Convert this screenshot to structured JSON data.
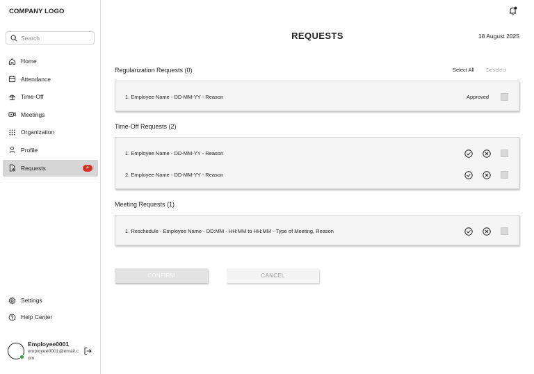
{
  "sidebar": {
    "logo": "COMPANY LOGO",
    "search_placeholder": "Search",
    "items": [
      {
        "label": "Home",
        "icon": "home-icon"
      },
      {
        "label": "Attendance",
        "icon": "calendar-icon"
      },
      {
        "label": "Time-Off",
        "icon": "beach-icon"
      },
      {
        "label": "Meetings",
        "icon": "video-icon"
      },
      {
        "label": "Organization",
        "icon": "grid-icon"
      },
      {
        "label": "Profile",
        "icon": "user-icon"
      },
      {
        "label": "Requests",
        "icon": "document-icon",
        "badge": "4",
        "active": true
      }
    ],
    "bottom_items": [
      {
        "label": "Settings",
        "icon": "gear-icon"
      },
      {
        "label": "Help Center",
        "icon": "help-icon"
      }
    ],
    "user": {
      "name": "Employee0001",
      "email": "employee0001@email.com"
    }
  },
  "header": {
    "title": "REQUESTS",
    "date": "18 August 2025"
  },
  "regularization": {
    "title": "Regularization Requests (0)",
    "select_all": "Select All",
    "deselect": "Deselect",
    "rows": [
      {
        "text": "1. Employee Name - DD-MM-YY - Reason",
        "status": "Approved"
      }
    ]
  },
  "timeoff": {
    "title": "Time-Off Requests (2)",
    "rows": [
      {
        "text": "1. Employee Name - DD-MM-YY - Reason"
      },
      {
        "text": "2. Employee Name - DD-MM-YY - Reason"
      }
    ]
  },
  "meeting": {
    "title": "Meeting Requests (1)",
    "rows": [
      {
        "text": "1. Reschedule - Employee Name - DD:MM - HH:MM to HH:MM - Type of Meeting, Reason"
      }
    ]
  },
  "actions": {
    "confirm": "CONFIRM",
    "cancel": "CANCEL"
  },
  "colors": {
    "active_nav_bg": "#d6d6d6",
    "badge": "#d93025",
    "online": "#2e9e44",
    "card_bg": "#f5f5f5"
  }
}
